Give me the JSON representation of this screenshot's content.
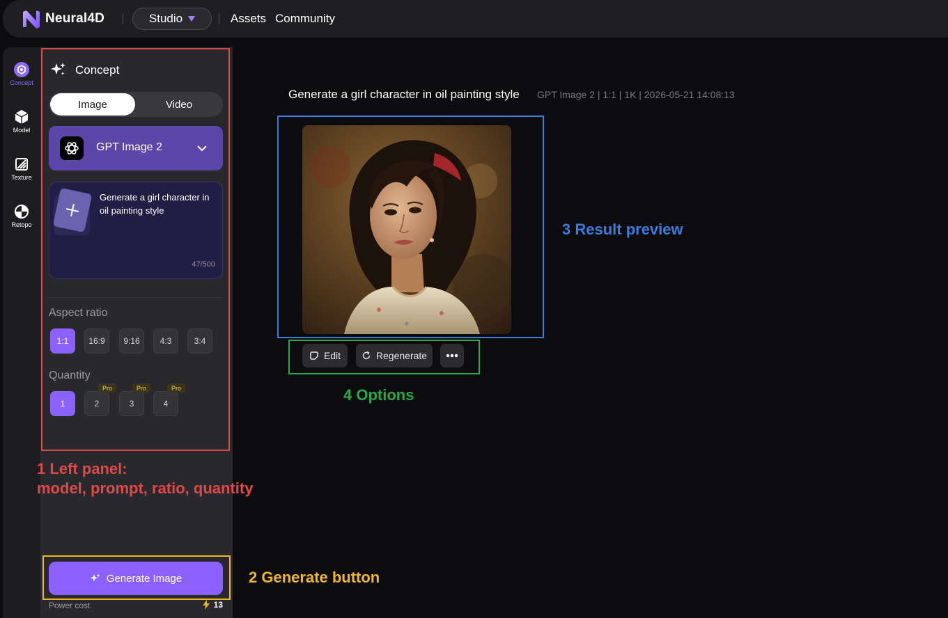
{
  "topbar": {
    "brand": "Neural4D",
    "studio_label": "Studio",
    "nav": [
      "Assets",
      "Community"
    ]
  },
  "rail": {
    "items": [
      {
        "label": "Concept",
        "icon": "concept-icon",
        "active": true
      },
      {
        "label": "Model",
        "icon": "cube-icon",
        "active": false
      },
      {
        "label": "Texture",
        "icon": "texture-icon",
        "active": false
      },
      {
        "label": "Retopo",
        "icon": "retopo-icon",
        "active": false
      }
    ]
  },
  "panel": {
    "title": "Concept",
    "modes": {
      "image": "Image",
      "video": "Video",
      "selected": "Image"
    },
    "model": {
      "name": "GPT Image 2",
      "icon": "openai-logo-icon"
    },
    "prompt": {
      "text": "Generate a girl character in oil painting style",
      "count": "47/500"
    },
    "aspect": {
      "label": "Aspect ratio",
      "options": [
        "1:1",
        "16:9",
        "9:16",
        "4:3",
        "3:4"
      ],
      "selected": "1:1"
    },
    "quantity": {
      "label": "Quantity",
      "options": [
        "1",
        "2",
        "3",
        "4"
      ],
      "selected": "1",
      "pro_badge": "Pro"
    },
    "generate_label": "Generate Image",
    "power_label": "Power cost",
    "power_value": "13"
  },
  "result": {
    "title": "Generate a girl character in oil painting style",
    "meta": "GPT Image 2 | 1:1 | 1K | 2026-05-21 14:08:13",
    "actions": {
      "edit": "Edit",
      "regenerate": "Regenerate",
      "more": "more-icon"
    }
  },
  "annotations": {
    "a1_line1": "1  Left panel:",
    "a1_line2": "model, prompt, ratio, quantity",
    "a2": "2  Generate button",
    "a3": "3  Result preview",
    "a4": "4  Options"
  },
  "colors": {
    "accent": "#8b62ff",
    "model_select": "#5a47a8",
    "annotation_red": "#e04848",
    "annotation_yellow": "#f0b72a",
    "annotation_blue": "#3a7de0",
    "annotation_green": "#2aa84a"
  }
}
